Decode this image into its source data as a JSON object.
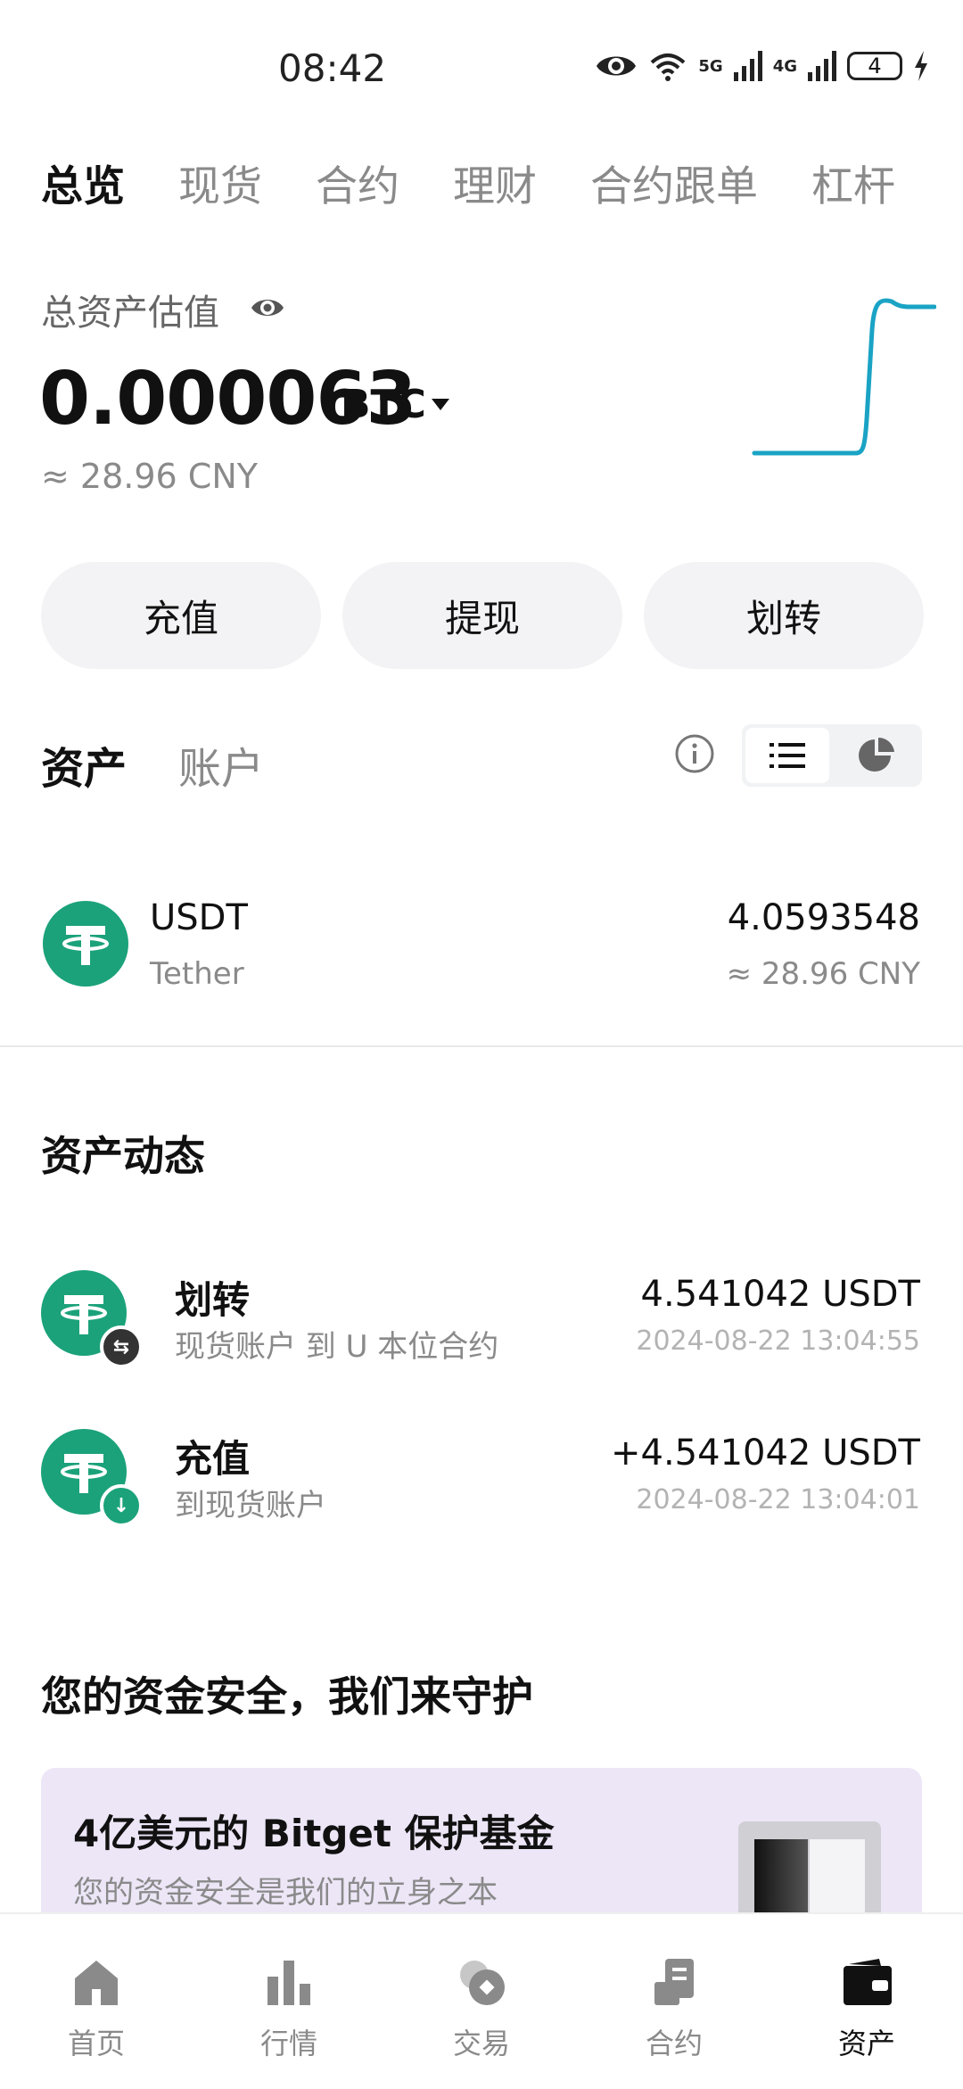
{
  "status_bar": {
    "time": "08:42",
    "network_5g": "5G",
    "network_4g": "4G",
    "wifi_label": "6",
    "battery": "4"
  },
  "top_tabs": [
    "总览",
    "现货",
    "合约",
    "理财",
    "合约跟单",
    "杠杆"
  ],
  "overview": {
    "label": "总资产估值",
    "balance": "0.000063",
    "unit": "BTC",
    "cny": "≈ 28.96 CNY"
  },
  "actions": {
    "deposit": "充值",
    "withdraw": "提现",
    "transfer": "划转"
  },
  "asset_tabs": {
    "assets": "资产",
    "accounts": "账户"
  },
  "asset": {
    "symbol": "USDT",
    "name": "Tether",
    "amount": "4.0593548",
    "cny": "≈ 28.96 CNY"
  },
  "activity": {
    "title": "资产动态",
    "items": [
      {
        "title": "划转",
        "subtitle": "现货账户 到 U 本位合约",
        "amount": "4.541042 USDT",
        "time": "2024-08-22 13:04:55"
      },
      {
        "title": "充值",
        "subtitle": "到现货账户",
        "amount": "+4.541042 USDT",
        "time": "2024-08-22 13:04:01"
      }
    ]
  },
  "security": {
    "title": "您的资金安全，我们来守护",
    "banner_title": "4亿美元的 Bitget 保护基金",
    "banner_sub": "您的资金安全是我们的立身之本"
  },
  "bottom_nav": [
    "首页",
    "行情",
    "交易",
    "合约",
    "资产"
  ],
  "colors": {
    "accent_line": "#1aa3c4",
    "tether_green": "#1ba27a",
    "banner_bg": "#ede6f7"
  }
}
